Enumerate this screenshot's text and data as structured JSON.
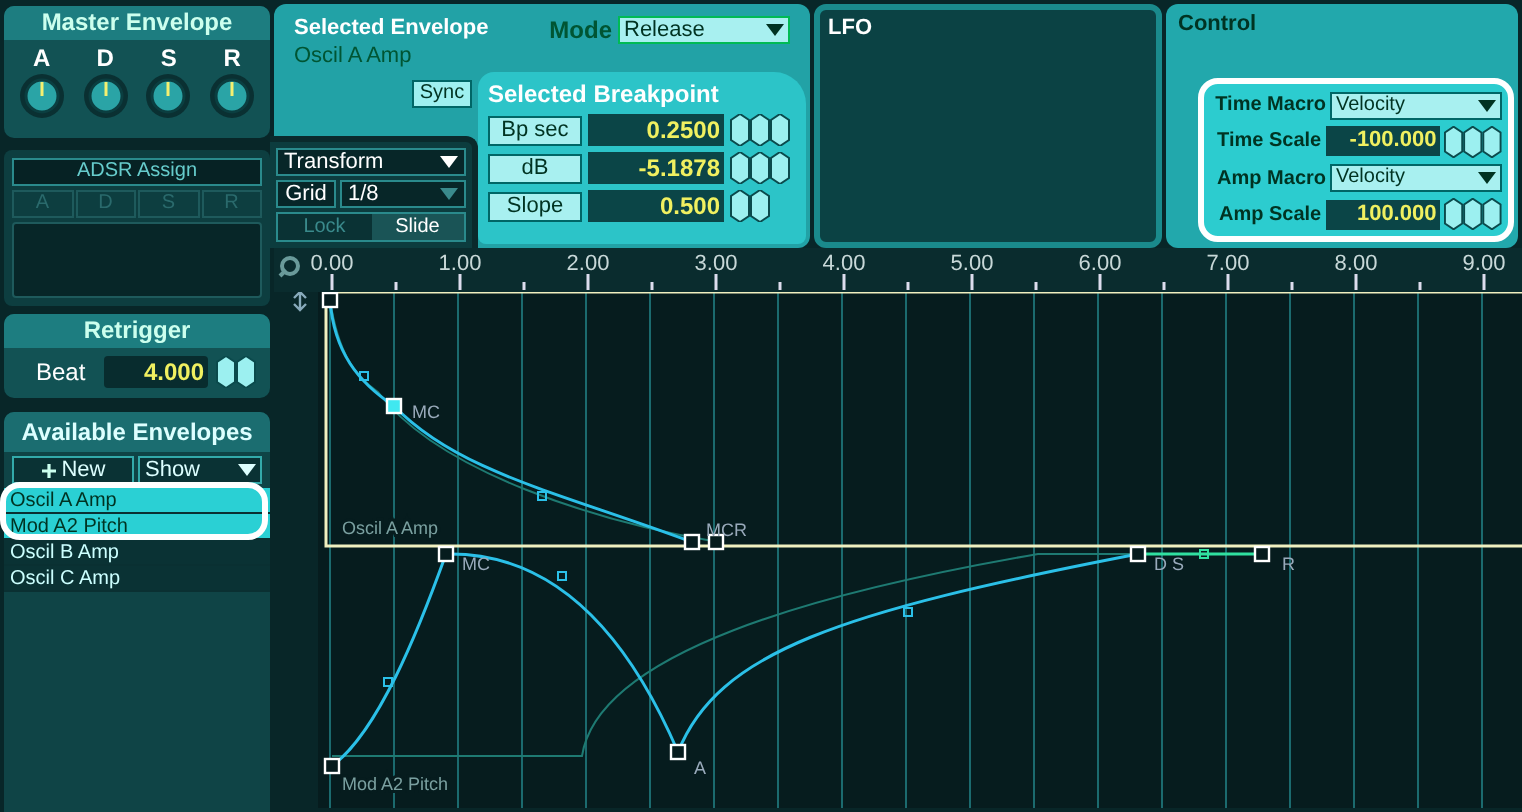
{
  "master_envelope": {
    "title": "Master Envelope",
    "knobs": [
      {
        "label": "A"
      },
      {
        "label": "D"
      },
      {
        "label": "S"
      },
      {
        "label": "R"
      }
    ]
  },
  "adsr_assign": {
    "title": "ADSR Assign",
    "slots": [
      {
        "label": "A",
        "disabled": true
      },
      {
        "label": "D",
        "disabled": true
      },
      {
        "label": "S",
        "disabled": true
      },
      {
        "label": "R",
        "disabled": true
      }
    ]
  },
  "retrigger": {
    "title": "Retrigger",
    "label": "Beat",
    "value": "4.000"
  },
  "available_envelopes": {
    "title": "Available Envelopes",
    "new_button": "New",
    "show": "Show",
    "items": [
      {
        "label": "Oscil A Amp",
        "selected": true
      },
      {
        "label": "Mod A2 Pitch",
        "selected": true
      },
      {
        "label": "Oscil B Amp",
        "selected": false
      },
      {
        "label": "Oscil C Amp",
        "selected": false
      }
    ]
  },
  "selected_envelope": {
    "title": "Selected Envelope",
    "name": "Oscil A Amp",
    "mode_label": "Mode",
    "mode": "Release",
    "sync": "Sync"
  },
  "selected_breakpoint": {
    "title": "Selected Breakpoint",
    "params": [
      {
        "label": "Bp sec",
        "value": "0.2500"
      },
      {
        "label": "dB",
        "value": "-5.1878"
      },
      {
        "label": "Slope",
        "value": "0.500"
      }
    ]
  },
  "tools": {
    "transform": "Transform",
    "grid_label": "Grid",
    "grid": "1/8",
    "modes": [
      {
        "label": "Lock",
        "selected": false
      },
      {
        "label": "Slide",
        "selected": true
      }
    ]
  },
  "lfo": {
    "title": "LFO"
  },
  "control": {
    "title": "Control",
    "params": [
      {
        "kind": "dropdown",
        "label": "Time Macro",
        "value": "Velocity"
      },
      {
        "kind": "number",
        "label": "Time Scale",
        "value": "-100.000"
      },
      {
        "kind": "dropdown",
        "label": "Amp Macro",
        "value": "Velocity"
      },
      {
        "kind": "number",
        "label": "Amp Scale",
        "value": "100.000"
      }
    ]
  },
  "ruler": {
    "labels": [
      "0.00",
      "1.00",
      "2.00",
      "3.00",
      "4.00",
      "5.00",
      "6.00",
      "7.00",
      "8.00",
      "9.00"
    ]
  },
  "graph": {
    "envelopes": [
      {
        "name": "Oscil A Amp",
        "point_labels": [
          "MC",
          "MCR"
        ]
      },
      {
        "name": "Mod A2 Pitch",
        "point_labels": [
          "MC",
          "A",
          "D S",
          "R"
        ]
      }
    ]
  }
}
